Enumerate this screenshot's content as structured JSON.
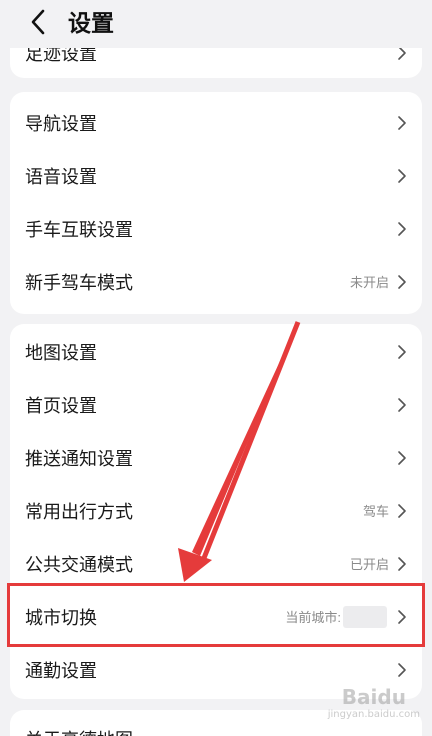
{
  "header": {
    "title": "设置",
    "back_icon": "chevron-left-icon"
  },
  "top_card": {
    "partial_label": "足迹设置"
  },
  "card1": {
    "items": [
      {
        "label": "导航设置",
        "value": ""
      },
      {
        "label": "语音设置",
        "value": ""
      },
      {
        "label": "手车互联设置",
        "value": ""
      },
      {
        "label": "新手驾车模式",
        "value": "未开启"
      }
    ]
  },
  "card2": {
    "items": [
      {
        "label": "地图设置",
        "value": ""
      },
      {
        "label": "首页设置",
        "value": ""
      },
      {
        "label": "推送通知设置",
        "value": ""
      },
      {
        "label": "常用出行方式",
        "value": "驾车"
      },
      {
        "label": "公共交通模式",
        "value": "已开启"
      },
      {
        "label": "城市切换",
        "value": "当前城市:"
      },
      {
        "label": "通勤设置",
        "value": ""
      }
    ]
  },
  "bottom_card": {
    "partial_label": "关于高德地图"
  },
  "colors": {
    "accent_red": "#e53b3b",
    "page_bg": "#f2f2f4",
    "card_bg": "#ffffff"
  },
  "watermark": {
    "text": "Baidu",
    "sub": "jingyan.baidu.com"
  }
}
